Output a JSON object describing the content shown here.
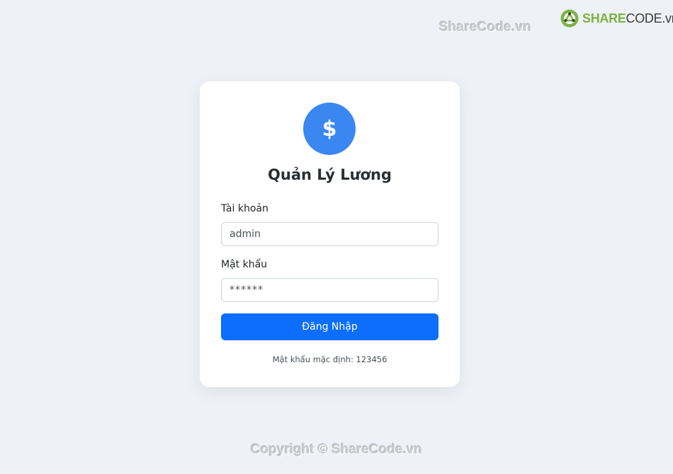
{
  "watermark": {
    "top": "ShareCode.vn",
    "bottom": "Copyright © ShareCode.vn"
  },
  "logo": {
    "part1": "SHARE",
    "part2": "CODE.vn",
    "icon": "sharecode-logo-icon"
  },
  "card": {
    "icon_glyph": "$",
    "icon": "dollar-icon",
    "title": "Quản Lý Lương",
    "username_label": "Tài khoản",
    "username_value": "admin",
    "password_label": "Mật khẩu",
    "password_value": "******",
    "submit_label": "Đăng Nhập",
    "hint": "Mật khẩu mặc định: 123456"
  },
  "colors": {
    "background": "#eef1f5",
    "accent": "#3b87f2",
    "button": "#0d6efd",
    "logo_green": "#7cb342"
  }
}
